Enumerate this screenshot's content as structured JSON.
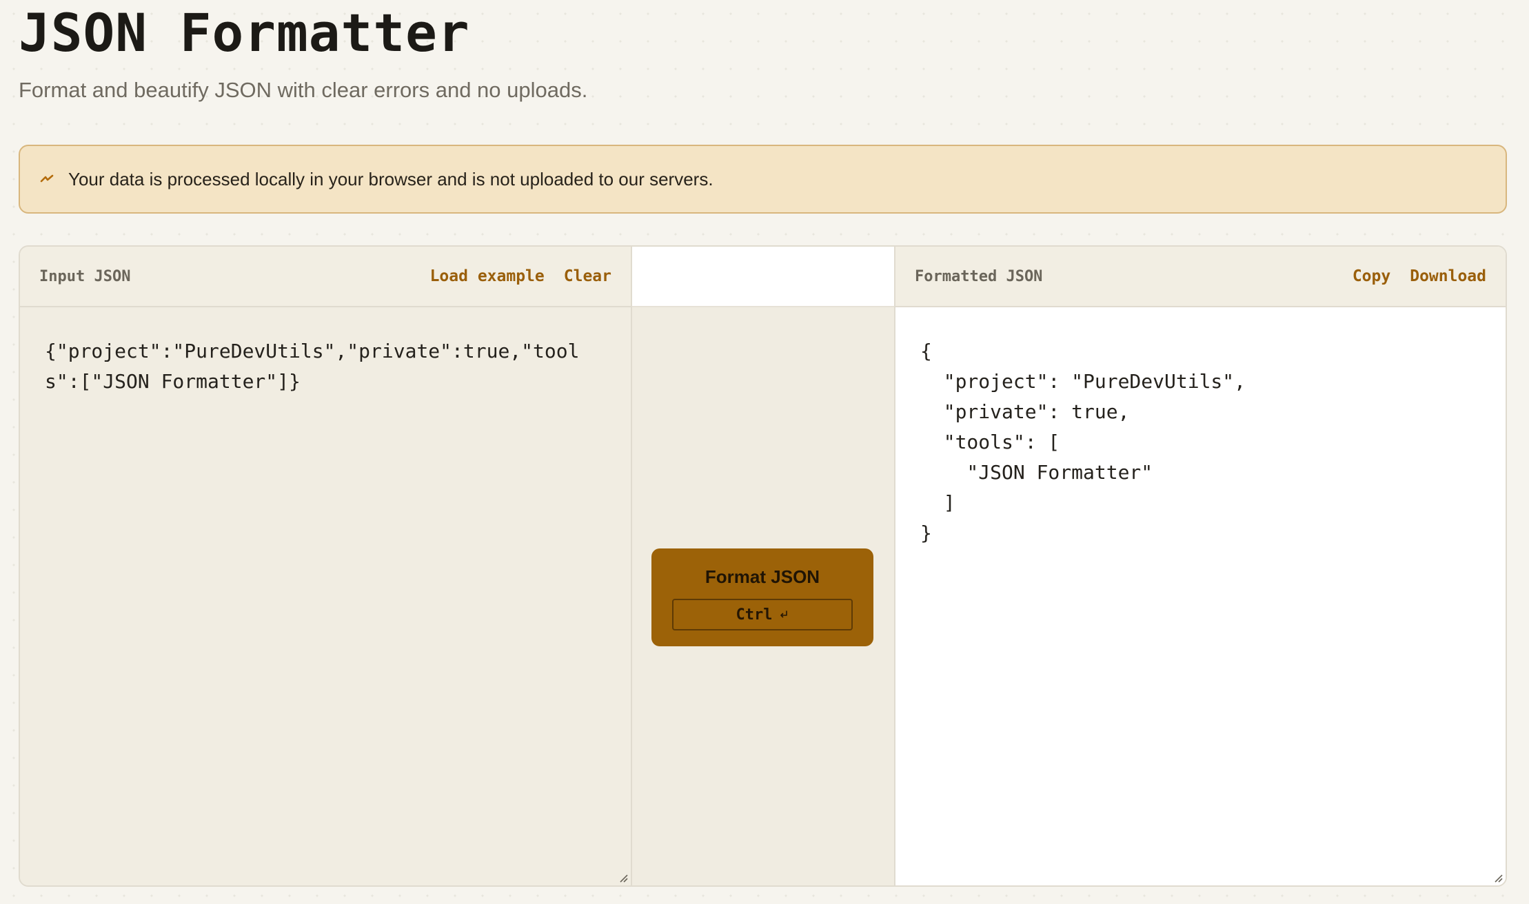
{
  "header": {
    "title": "JSON Formatter",
    "subtitle": "Format and beautify JSON with clear errors and no uploads."
  },
  "notice": {
    "icon": "lightning-icon",
    "text": "Your data is processed locally in your browser and is not uploaded to our servers."
  },
  "input_pane": {
    "label": "Input JSON",
    "load_example": "Load example",
    "clear": "Clear",
    "value": "{\"project\":\"PureDevUtils\",\"private\":true,\"tools\":[\"JSON Formatter\"]}"
  },
  "action": {
    "format_label": "Format JSON",
    "shortcut_key": "Ctrl",
    "shortcut_icon": "enter-icon"
  },
  "output_pane": {
    "label": "Formatted JSON",
    "copy": "Copy",
    "download": "Download",
    "value": "{\n  \"project\": \"PureDevUtils\",\n  \"private\": true,\n  \"tools\": [\n    \"JSON Formatter\"\n  ]\n}"
  },
  "colors": {
    "accent": "#9c6208",
    "link": "#9a5f0b",
    "notice_bg": "#f4e4c5",
    "notice_border": "#d8b67d",
    "page_bg": "#f6f4ee"
  }
}
